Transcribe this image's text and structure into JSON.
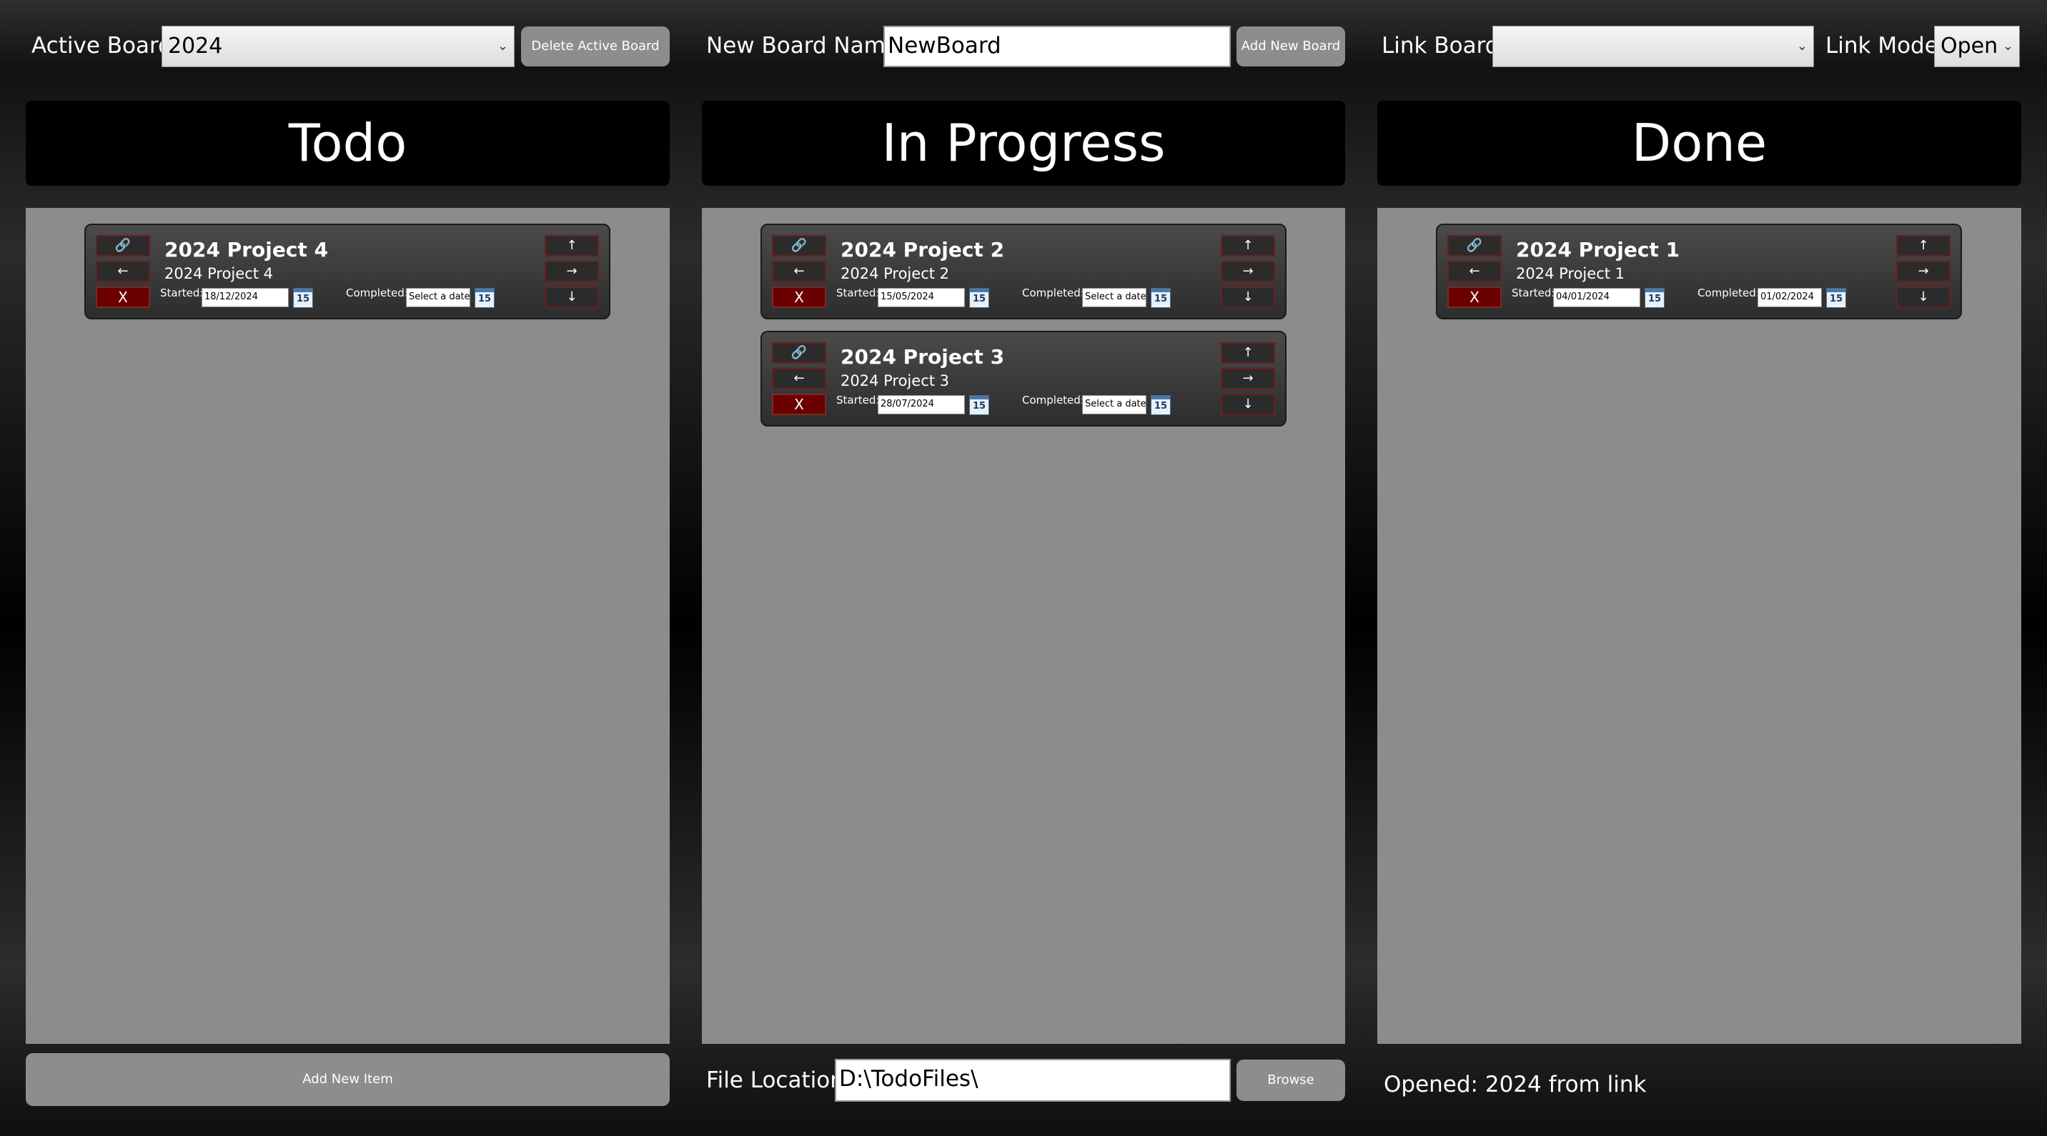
{
  "top": {
    "active_board_label": "Active Board:",
    "active_board_value": "2024",
    "delete_button": "Delete Active Board",
    "new_board_label": "New Board Name:",
    "new_board_value": "NewBoard",
    "add_board_button": "Add New Board",
    "link_board_label": "Link Board:",
    "link_board_value": "",
    "link_mode_label": "Link Mode:",
    "link_mode_value": "Open"
  },
  "columns": [
    {
      "title": "Todo"
    },
    {
      "title": "In Progress"
    },
    {
      "title": "Done"
    }
  ],
  "cards": [
    {
      "title": "2024 Project 4",
      "subtitle": "2024 Project 4",
      "started_label": "Started:",
      "started": "18/12/2024",
      "completed_label": "Completed:",
      "completed": "Select a date",
      "cal": "15",
      "delete": "X",
      "left": "←",
      "up": "↑",
      "right": "→",
      "down": "↓"
    },
    {
      "title": "2024 Project 2",
      "subtitle": "2024 Project 2",
      "started_label": "Started:",
      "started": "15/05/2024",
      "completed_label": "Completed:",
      "completed": "Select a date",
      "cal": "15",
      "delete": "X",
      "left": "←",
      "up": "↑",
      "right": "→",
      "down": "↓"
    },
    {
      "title": "2024 Project 3",
      "subtitle": "2024 Project 3",
      "started_label": "Started:",
      "started": "28/07/2024",
      "completed_label": "Completed:",
      "completed": "Select a date",
      "cal": "15",
      "delete": "X",
      "left": "←",
      "up": "↑",
      "right": "→",
      "down": "↓"
    },
    {
      "title": "2024 Project 1",
      "subtitle": "2024 Project 1",
      "started_label": "Started:",
      "started": "04/01/2024",
      "completed_label": "Completed:",
      "completed": "01/02/2024",
      "cal": "15",
      "delete": "X",
      "left": "←",
      "up": "↑",
      "right": "→",
      "down": "↓"
    }
  ],
  "bottom": {
    "add_item_button": "Add New Item",
    "file_location_label": "File Location:",
    "file_location_value": "D:\\TodoFiles\\",
    "browse_button": "Browse",
    "status": "Opened: 2024 from link"
  },
  "icons": {
    "link": "link-icon",
    "dropdown": "chevron-down-icon",
    "calendar": "calendar-icon"
  }
}
